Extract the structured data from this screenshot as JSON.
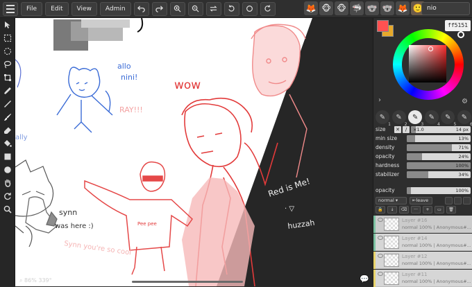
{
  "menu": {
    "file": "File",
    "edit": "Edit",
    "view": "View",
    "admin": "Admin"
  },
  "toolbar_icons": [
    "hamburger-icon",
    "undo-icon",
    "redo-icon",
    "zoom-in-icon",
    "zoom-out-icon",
    "flip-icon",
    "rotate-left-icon",
    "reset-rotation-icon",
    "rotate-right-icon"
  ],
  "users": {
    "avatars": [
      "🦊",
      "🐵",
      "🐵",
      "🦈",
      "🐨",
      "🐨",
      "🦊",
      "🙂"
    ],
    "current_name": "nio"
  },
  "canvas": {
    "zoom_text": "86% 339°",
    "texts": {
      "wow": "wow",
      "allo": "allo",
      "nini": "nini!",
      "ray": "RAY!!!",
      "synn": "synn",
      "was_here": "was here :)",
      "synn_cool": "Synn you're so cool",
      "pee_pee": "Pee pee",
      "red_is_me": "Red is Me!",
      "huzzah": "huzzah"
    }
  },
  "color": {
    "primary": "#ff5151",
    "secondary": "#e7a92a",
    "hex": "ff5151"
  },
  "brushes": {
    "numbers": [
      "1",
      "2",
      "3",
      "4",
      "5",
      "6"
    ],
    "active_index": 3
  },
  "brush_settings": {
    "size_label": "size",
    "size_x": "×1.0",
    "size_value": "14 px",
    "size_level": 0.08,
    "min_size_label": "min size",
    "min_size_value": "13%",
    "min_size_level": 0.13,
    "density_label": "density",
    "density_value": "71%",
    "density_level": 0.71,
    "opacity_label": "opacity",
    "opacity_value": "24%",
    "opacity_level": 0.24,
    "hardness_label": "hardness",
    "hardness_value": "100%",
    "hardness_level": 1.0,
    "stabilizer_label": "stabilizer",
    "stabilizer_value": "34%",
    "stabilizer_level": 0.34
  },
  "layer_panel": {
    "opacity_label": "opacity",
    "opacity_value": "100%",
    "blend_mode": "normal",
    "leave_label": "leave",
    "layers": [
      {
        "name": "Layer #16",
        "meta": "normal 100% | Anonymous#...",
        "color": "#7ac1a0"
      },
      {
        "name": "Layer #14",
        "meta": "normal 100% | Anonymous#...",
        "color": "#7ac1a0"
      },
      {
        "name": "Layer #12",
        "meta": "normal 100% | Anonymous#...",
        "color": "#e8d36a"
      },
      {
        "name": "Layer #11",
        "meta": "normal 100% | Anonymous#...",
        "color": "#e8d36a"
      }
    ]
  }
}
